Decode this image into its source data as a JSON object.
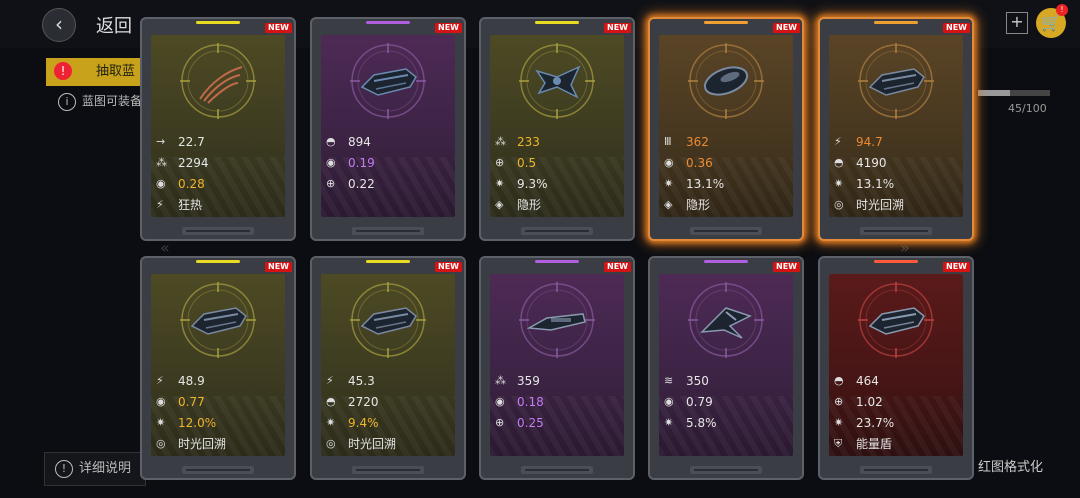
{
  "header": {
    "back_label": "返回",
    "back_icon": "‹"
  },
  "bg": {
    "tab_label": "抽取蓝",
    "info_text": "蓝图可装备",
    "progress_text": "45/100",
    "progress": 0.45,
    "bottom_left": "详细说明",
    "bottom_right": "红图格式化",
    "plus": "+"
  },
  "new_label": "NEW",
  "cards": [
    {
      "tier": "yellow",
      "glow": false,
      "ship": "claw",
      "color": "#c06a4a",
      "stats": [
        {
          "icon": "→",
          "value": "22.7",
          "vc": "w"
        },
        {
          "icon": "⁂",
          "value": "2294",
          "vc": "w"
        },
        {
          "icon": "◉",
          "value": "0.28",
          "vc": "y"
        },
        {
          "icon": "⚡",
          "value": "狂热",
          "vc": "w"
        }
      ]
    },
    {
      "tier": "purple",
      "glow": false,
      "ship": "gunship",
      "color": "#6a8ab0",
      "stats": [
        {
          "icon": "◓",
          "value": "894",
          "vc": "w"
        },
        {
          "icon": "◉",
          "value": "0.19",
          "vc": "p"
        },
        {
          "icon": "⊕",
          "value": "0.22",
          "vc": "w"
        }
      ]
    },
    {
      "tier": "yellow",
      "glow": false,
      "ship": "fighter",
      "color": "#6a8ab0",
      "stats": [
        {
          "icon": "⁂",
          "value": "233",
          "vc": "y"
        },
        {
          "icon": "⊕",
          "value": "0.5",
          "vc": "y"
        },
        {
          "icon": "✷",
          "value": "9.3%",
          "vc": "w"
        },
        {
          "icon": "◈",
          "value": "隐形",
          "vc": "w"
        }
      ]
    },
    {
      "tier": "orange",
      "glow": true,
      "ship": "pod",
      "color": "#7a8aa0",
      "stats": [
        {
          "icon": "Ⅲ",
          "value": "362",
          "vc": "o"
        },
        {
          "icon": "◉",
          "value": "0.36",
          "vc": "o"
        },
        {
          "icon": "✷",
          "value": "13.1%",
          "vc": "w"
        },
        {
          "icon": "◈",
          "value": "隐形",
          "vc": "w"
        }
      ]
    },
    {
      "tier": "orange",
      "glow": true,
      "ship": "cruiser",
      "color": "#7a8aa0",
      "stats": [
        {
          "icon": "⚡",
          "value": "94.7",
          "vc": "o"
        },
        {
          "icon": "◓",
          "value": "4190",
          "vc": "w"
        },
        {
          "icon": "✷",
          "value": "13.1%",
          "vc": "w"
        },
        {
          "icon": "◎",
          "value": "时光回溯",
          "vc": "w"
        }
      ]
    },
    {
      "tier": "yellow",
      "glow": false,
      "ship": "cruiser",
      "color": "#7a8aa0",
      "stats": [
        {
          "icon": "⚡",
          "value": "48.9",
          "vc": "w"
        },
        {
          "icon": "◉",
          "value": "0.77",
          "vc": "y"
        },
        {
          "icon": "✷",
          "value": "12.0%",
          "vc": "y"
        },
        {
          "icon": "◎",
          "value": "时光回溯",
          "vc": "w"
        }
      ]
    },
    {
      "tier": "yellow",
      "glow": false,
      "ship": "cruiser",
      "color": "#7a8aa0",
      "stats": [
        {
          "icon": "⚡",
          "value": "45.3",
          "vc": "w"
        },
        {
          "icon": "◓",
          "value": "2720",
          "vc": "w"
        },
        {
          "icon": "✷",
          "value": "9.4%",
          "vc": "y"
        },
        {
          "icon": "◎",
          "value": "时光回溯",
          "vc": "w"
        }
      ]
    },
    {
      "tier": "purple",
      "glow": false,
      "ship": "frigate",
      "color": "#8a9ab0",
      "stats": [
        {
          "icon": "⁂",
          "value": "359",
          "vc": "w"
        },
        {
          "icon": "◉",
          "value": "0.18",
          "vc": "p"
        },
        {
          "icon": "⊕",
          "value": "0.25",
          "vc": "p"
        }
      ]
    },
    {
      "tier": "purple",
      "glow": false,
      "ship": "interceptor",
      "color": "#8a9ab0",
      "stats": [
        {
          "icon": "≋",
          "value": "350",
          "vc": "w"
        },
        {
          "icon": "◉",
          "value": "0.79",
          "vc": "w"
        },
        {
          "icon": "✷",
          "value": "5.8%",
          "vc": "w"
        }
      ]
    },
    {
      "tier": "red",
      "glow": false,
      "ship": "cruiser",
      "color": "#8a9ab0",
      "stats": [
        {
          "icon": "◓",
          "value": "464",
          "vc": "w"
        },
        {
          "icon": "⊕",
          "value": "1.02",
          "vc": "w"
        },
        {
          "icon": "✷",
          "value": "23.7%",
          "vc": "w"
        },
        {
          "icon": "⛨",
          "value": "能量盾",
          "vc": "w"
        }
      ]
    }
  ]
}
